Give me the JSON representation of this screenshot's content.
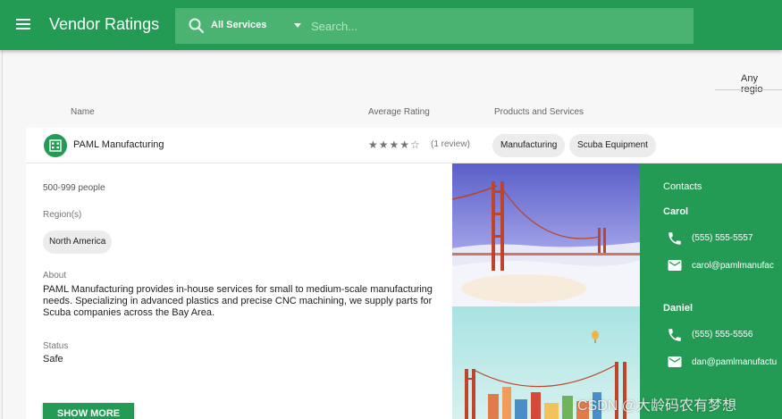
{
  "app": {
    "title": "Vendor Ratings"
  },
  "search": {
    "service_filter": "All Services",
    "placeholder": "Search..."
  },
  "filters": {
    "region": "Any regio"
  },
  "columns": {
    "name": "Name",
    "rating": "Average Rating",
    "products": "Products and Services"
  },
  "vendor": {
    "name": "PAML Manufacturing",
    "rating": 4,
    "rating_max": 5,
    "stars_text": "★★★★☆",
    "reviews": "(1 review)",
    "tags": [
      "Manufacturing",
      "Scuba Equipment"
    ],
    "size": "500-999 people",
    "regions_label": "Region(s)",
    "region": "North America",
    "about_label": "About",
    "about": "PAML Manufacturing provides in-house services for small to medium-scale manufacturing needs. Specializing in advanced plastics and precise CNC machining, we supply parts for Scuba companies across the Bay Area.",
    "status_label": "Status",
    "status": "Safe",
    "show_more": "SHOW MORE"
  },
  "contacts": {
    "heading": "Contacts",
    "people": [
      {
        "name": "Carol",
        "phone": "(555) 555-5557",
        "email": "carol@pamlmanufac"
      },
      {
        "name": "Daniel",
        "phone": "(555) 555-5556",
        "email": "dan@pamlmanufactu"
      }
    ]
  },
  "watermark": "CSDN @大龄码农有梦想",
  "colors": {
    "primary": "#239b54",
    "search_bg": "#4ab371",
    "chip_bg": "#ececec"
  }
}
